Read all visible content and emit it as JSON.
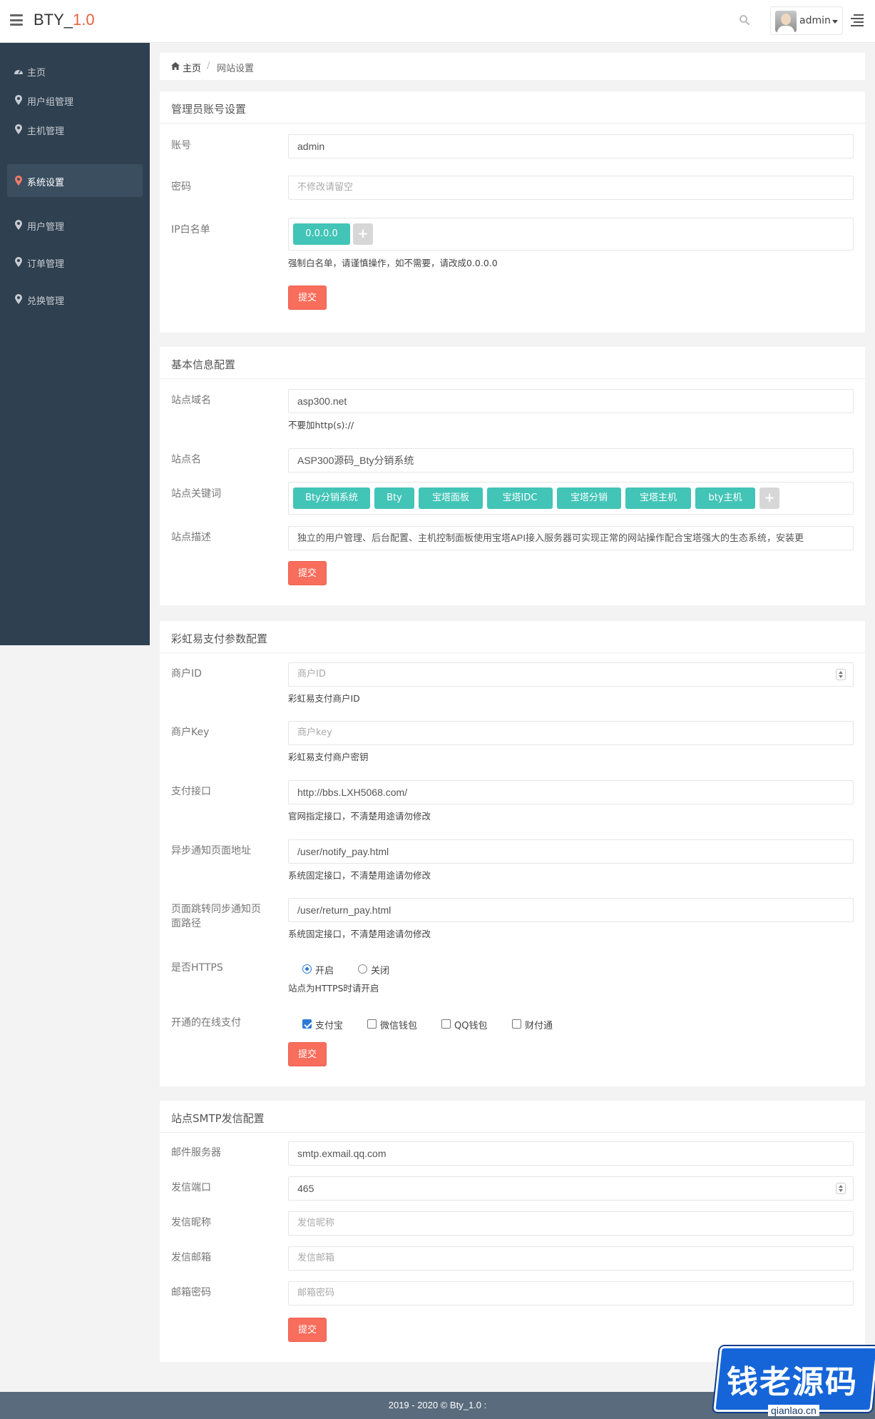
{
  "topbar": {
    "brand_main": "BTY_",
    "brand_version": "1.0",
    "username": "admin"
  },
  "sidebar": {
    "items": [
      {
        "label": "主页",
        "icon": "dashboard-icon"
      },
      {
        "label": "用户组管理",
        "icon": "map-marker-icon"
      },
      {
        "label": "主机管理",
        "icon": "map-marker-icon"
      },
      {
        "label": "系统设置",
        "icon": "map-marker-icon",
        "active": true
      },
      {
        "label": "用户管理",
        "icon": "map-marker-icon"
      },
      {
        "label": "订单管理",
        "icon": "map-marker-icon"
      },
      {
        "label": "兑换管理",
        "icon": "map-marker-icon"
      }
    ]
  },
  "breadcrumb": {
    "home": "主页",
    "separator": "/",
    "current": "网站设置"
  },
  "admin_panel": {
    "title": "管理员账号设置",
    "account_label": "账号",
    "account_value": "admin",
    "password_label": "密码",
    "password_placeholder": "不修改请留空",
    "ip_label": "IP白名单",
    "ip_tags": [
      "0.0.0.0"
    ],
    "ip_help": "强制白名单，请谨慎操作，如不需要，请改成0.0.0.0",
    "submit": "提交"
  },
  "basic_panel": {
    "title": "基本信息配置",
    "domain_label": "站点域名",
    "domain_value": "asp300.net",
    "domain_help": "不要加http(s)://",
    "sitename_label": "站点名",
    "sitename_value": "ASP300源码_Bty分销系统",
    "keywords_label": "站点关键词",
    "keywords": [
      "Bty分销系统",
      "Bty",
      "宝塔面板",
      "宝塔IDC",
      "宝塔分销",
      "宝塔主机",
      "bty主机"
    ],
    "desc_label": "站点描述",
    "desc_value": "独立的用户管理、后台配置、主机控制面板使用宝塔API接入服务器可实现正常的网站操作配合宝塔强大的生态系统，安装更",
    "submit": "提交"
  },
  "pay_panel": {
    "title": "彩虹易支付参数配置",
    "merchant_id_label": "商户ID",
    "merchant_id_placeholder": "商户ID",
    "merchant_id_help": "彩虹易支付商户ID",
    "merchant_key_label": "商户Key",
    "merchant_key_placeholder": "商户key",
    "merchant_key_help": "彩虹易支付商户密钥",
    "api_label": "支付接口",
    "api_value": "http://bbs.LXH5068.com/",
    "api_help": "官网指定接口，不清楚用途请勿修改",
    "notify_label": "异步通知页面地址",
    "notify_value": "/user/notify_pay.html",
    "notify_help": "系统固定接口，不清楚用途请勿修改",
    "return_label": "页面跳转同步通知页面路径",
    "return_value": "/user/return_pay.html",
    "return_help": "系统固定接口，不清楚用途请勿修改",
    "https_label": "是否HTTPS",
    "https_on": "开启",
    "https_off": "关闭",
    "https_help": "站点为HTTPS时请开启",
    "methods_label": "开通的在线支付",
    "methods": [
      {
        "label": "支付宝",
        "checked": true
      },
      {
        "label": "微信钱包",
        "checked": false
      },
      {
        "label": "QQ钱包",
        "checked": false
      },
      {
        "label": "财付通",
        "checked": false
      }
    ],
    "submit": "提交"
  },
  "smtp_panel": {
    "title": "站点SMTP发信配置",
    "server_label": "邮件服务器",
    "server_value": "smtp.exmail.qq.com",
    "port_label": "发信端口",
    "port_value": "465",
    "nick_label": "发信昵称",
    "nick_placeholder": "发信昵称",
    "email_label": "发信邮箱",
    "email_placeholder": "发信邮箱",
    "pass_label": "邮箱密码",
    "pass_placeholder": "邮箱密码",
    "submit": "提交"
  },
  "footer": {
    "text": "2019 - 2020 © Bty_1.0 :"
  },
  "watermark": {
    "text": "钱老源码",
    "url": "qianlao.cn"
  },
  "colors": {
    "sidebar_bg": "#2f4050",
    "tag_bg": "#42c4b7",
    "submit_bg": "#f96d5c",
    "brand_version": "#e9603a"
  }
}
